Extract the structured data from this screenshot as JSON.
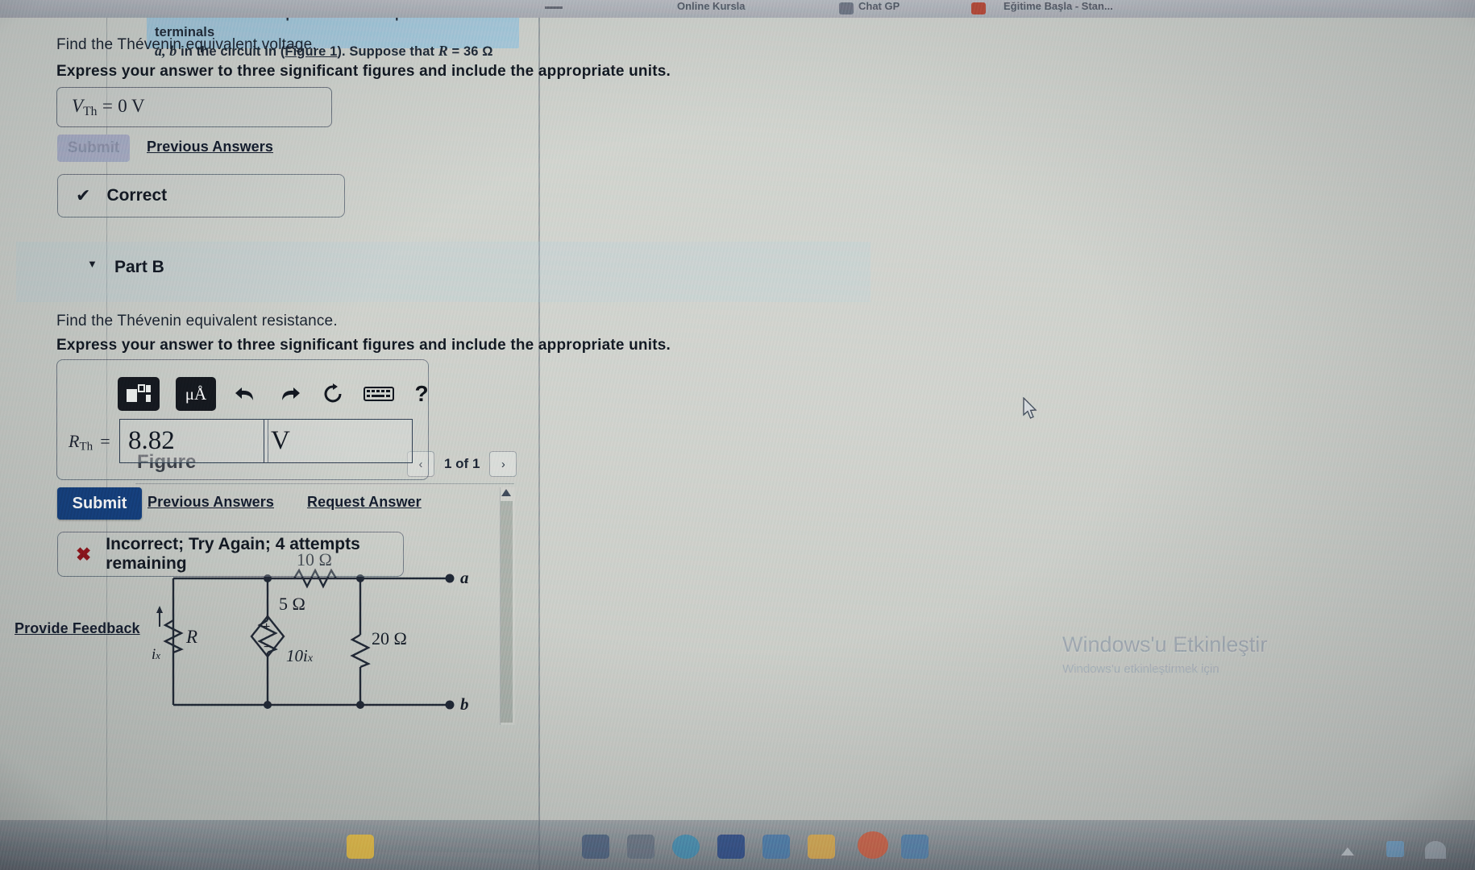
{
  "browser_chrome": {
    "tabs": [
      {
        "label": "Online Kursla"
      },
      {
        "label": "Chat GP"
      },
      {
        "label": "Eğitime Başla - Stan..."
      }
    ]
  },
  "left_panel": {
    "question_banner": {
      "line1_a": "Find the Thévenin equivalent with respect to the terminals",
      "line2_a": "a, b",
      "line2_b": "in the circuit in (",
      "line2_link": "Figure 1",
      "line2_c": "). Suppose that ",
      "line2_var": "R",
      "line2_eq": " = 36 ",
      "line2_unit": "Ω"
    },
    "figure": {
      "title": "Figure",
      "prev_icon": "chevron-left-icon",
      "next_icon": "chevron-right-icon",
      "pager_label": "1 of 1",
      "circuit_labels": {
        "r10": "10 Ω",
        "r5": "5 Ω",
        "r20": "20 Ω",
        "rvar": "R",
        "current": "ix",
        "dep_source": "10ix",
        "plus": "+",
        "minus": "−",
        "terminal_a": "a",
        "terminal_b": "b"
      }
    }
  },
  "part_a": {
    "prompt": "Find the Thévenin equivalent voltage.",
    "instruction": "Express your answer to three significant figures and include the appropriate units.",
    "answer_var": "V",
    "answer_sub": "Th",
    "answer_eq": "=",
    "answer_value": "0 V",
    "submit_label": "Submit",
    "previous_answers_label": "Previous Answers",
    "status_icon": "check-icon",
    "status_label": "Correct"
  },
  "part_b": {
    "header_label": "Part B",
    "collapse_icon": "caret-down-icon",
    "prompt": "Find the Thévenin equivalent resistance.",
    "instruction": "Express your answer to three significant figures and include the appropriate units.",
    "toolbar": {
      "template_icon": "math-template-icon",
      "units_icon": "units-micro-angstrom-icon",
      "units_label": "μÅ",
      "undo_icon": "undo-arrow-icon",
      "redo_icon": "redo-arrow-icon",
      "reset_icon": "reset-circular-arrow-icon",
      "keyboard_icon": "keyboard-icon",
      "help_icon": "question-mark-icon",
      "help_label": "?"
    },
    "answer_var": "R",
    "answer_sub": "Th",
    "answer_eq": "=",
    "answer_value": "8.82",
    "answer_units": "V",
    "submit_label": "Submit",
    "previous_answers_label": "Previous Answers",
    "request_answer_label": "Request Answer",
    "status_icon": "cross-icon",
    "status_label": "Incorrect; Try Again; 4 attempts remaining"
  },
  "footer": {
    "provide_feedback_label": "Provide Feedback"
  },
  "watermark": {
    "title": "Windows'u Etkinleştir",
    "subtitle": "Windows'u etkinleştirmek için"
  },
  "colors": {
    "banner_blue": "#a6cadd",
    "submit_blue": "#123c78",
    "correct_check": "#141a24",
    "incorrect_cross": "#8d1117",
    "page_bg": "#c9ccc6"
  }
}
